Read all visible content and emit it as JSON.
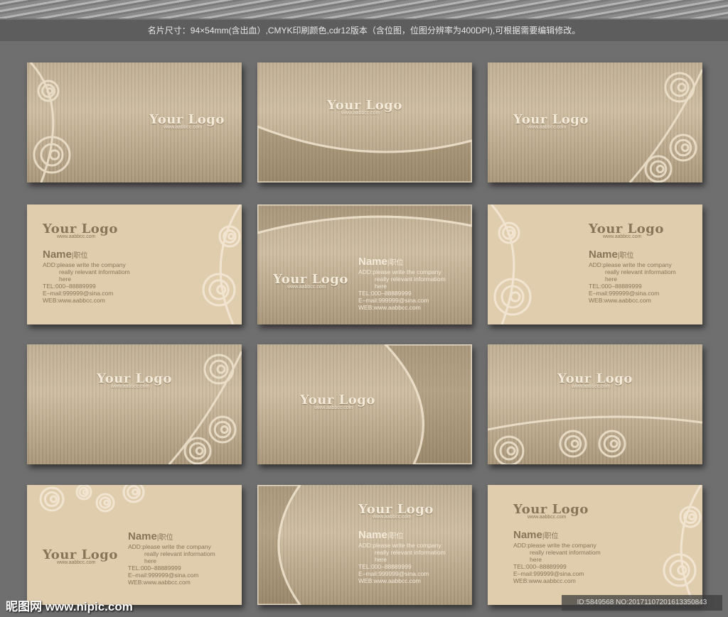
{
  "caption": "名片尺寸：94×54mm(含出血）,CMYK印刷颜色,cdr12版本（含位图，位图分辨率为400DPI),可根据需要编辑修改。",
  "watermark": "昵图网 www.nipic.com",
  "id_text": "ID:5849568 NO:20171107201613350843",
  "colors": {
    "background": "#6f6f6f",
    "card_flat": "#e0cdae",
    "card_text": "#8a7457"
  },
  "cards": [
    {
      "logo": "Your Logo",
      "url": "www.aabbcc.com"
    },
    {
      "logo": "Your Logo",
      "url": "www.aabbcc.com"
    },
    {
      "logo": "Your Logo",
      "url": "www.aabbcc.com"
    },
    {
      "logo": "Your Logo",
      "url": "www.aabbcc.com",
      "name": "Name",
      "title": "职位",
      "add": [
        "ADD:please write the company",
        "really relevant informatiom",
        "here"
      ],
      "tel": "TEL:000–88889999",
      "email": "E–mail:999999@sina.com",
      "web": "WEB:www.aabbcc.com"
    },
    {
      "logo": "Your Logo",
      "url": "www.aabbcc.com",
      "name": "Name",
      "title": "职位",
      "add": [
        "ADD:please write the company",
        "really relevant informatiom",
        "here"
      ],
      "tel": "TEL:000–88889999",
      "email": "E–mail:999999@sina.com",
      "web": "WEB:www.aabbcc.com"
    },
    {
      "logo": "Your Logo",
      "url": "www.aabbcc.com",
      "name": "Name",
      "title": "职位",
      "add": [
        "ADD:please write the company",
        "really relevant informatiom",
        "here"
      ],
      "tel": "TEL:000–88889999",
      "email": "E–mail:999999@sina.com",
      "web": "WEB:www.aabbcc.com"
    },
    {
      "logo": "Your Logo",
      "url": "www.aabbcc.com"
    },
    {
      "logo": "Your Logo",
      "url": "www.aabbcc.com"
    },
    {
      "logo": "Your Logo",
      "url": "www.aabbcc.com"
    },
    {
      "logo": "Your Logo",
      "url": "www.aabbcc.com",
      "name": "Name",
      "title": "职位",
      "add": [
        "ADD:please write the company",
        "really relevant informatiom",
        "here"
      ],
      "tel": "TEL:000–88889999",
      "email": "E–mail:999999@sina.com",
      "web": "WEB:www.aabbcc.com"
    },
    {
      "logo": "Your Logo",
      "url": "www.aabbcc.com",
      "name": "Name",
      "title": "职位",
      "add": [
        "ADD:please write the company",
        "really relevant informatiom",
        "here"
      ],
      "tel": "TEL:000–88889999",
      "email": "E–mail:999999@sina.com",
      "web": "WEB:www.aabbcc.com"
    },
    {
      "logo": "Your Logo",
      "url": "www.aabbcc.com",
      "name": "Name",
      "title": "职位",
      "add": [
        "ADD:please write the company",
        "really relevant informatiom",
        "here"
      ],
      "tel": "TEL:000–88889999",
      "email": "E–mail:999999@sina.com",
      "web": "WEB:www.aabbcc.com"
    }
  ]
}
